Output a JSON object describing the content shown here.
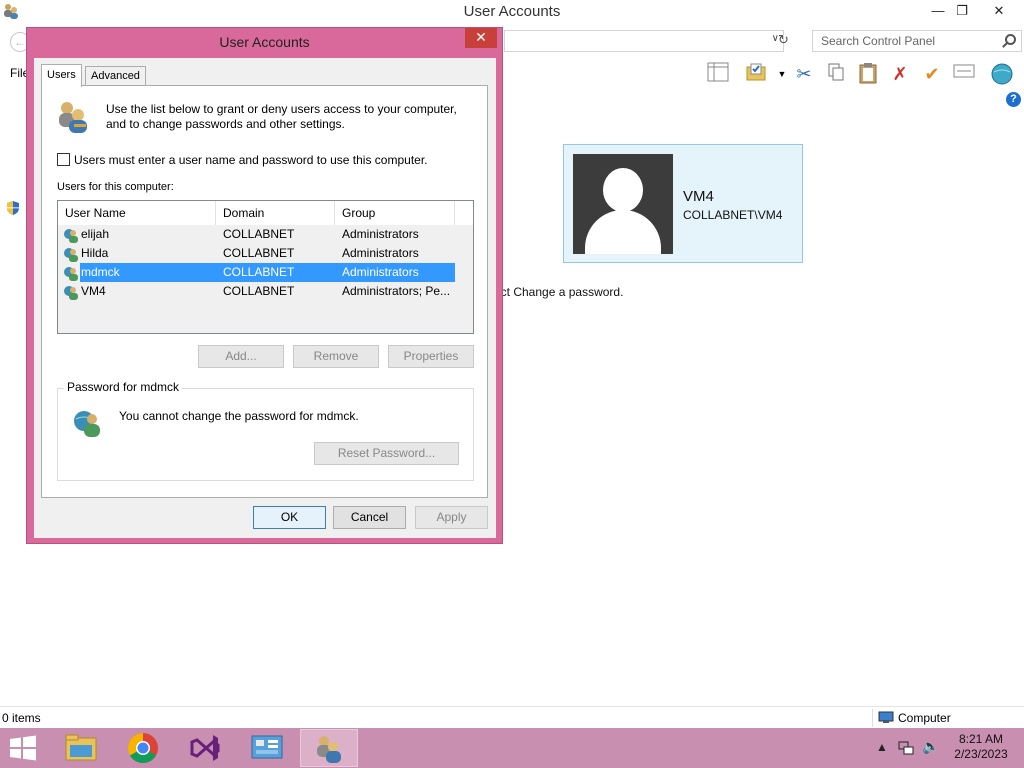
{
  "background_window": {
    "title": "User Accounts",
    "menu_file": "File",
    "search_placeholder": "Search Control Panel",
    "user_tile": {
      "name": "VM4",
      "domain": "COLLABNET\\VM4"
    },
    "hint_text": "ect Change a password.",
    "status_items": "0 items",
    "status_location": "Computer"
  },
  "dialog": {
    "title": "User Accounts",
    "tabs": [
      {
        "label": "Users"
      },
      {
        "label": "Advanced"
      }
    ],
    "intro_line1": "Use the list below to grant or deny users access to your computer,",
    "intro_line2": "and to change passwords and other settings.",
    "require_login_label": "Users must enter a user name and password to use this computer.",
    "users_caption": "Users for this computer:",
    "columns": [
      "User Name",
      "Domain",
      "Group"
    ],
    "users": [
      {
        "name": "elijah",
        "domain": "COLLABNET",
        "group": "Administrators"
      },
      {
        "name": "Hilda",
        "domain": "COLLABNET",
        "group": "Administrators"
      },
      {
        "name": "mdmck",
        "domain": "COLLABNET",
        "group": "Administrators"
      },
      {
        "name": "VM4",
        "domain": "COLLABNET",
        "group": "Administrators; Pe..."
      }
    ],
    "selected_user_index": 2,
    "add_label": "Add...",
    "remove_label": "Remove",
    "properties_label": "Properties",
    "password_group_label": "Password for mdmck",
    "password_text": "You cannot change the password for mdmck.",
    "reset_password_label": "Reset Password...",
    "ok_label": "OK",
    "cancel_label": "Cancel",
    "apply_label": "Apply"
  },
  "taskbar": {
    "time": "8:21 AM",
    "date": "2/23/2023",
    "apps": [
      "file-explorer",
      "chrome",
      "visual-studio",
      "control-panel",
      "user-accounts"
    ]
  },
  "colors": {
    "dialog_frame": "#d9699a",
    "taskbar": "#c98fb0",
    "selection": "#3399ff",
    "close_button": "#c7403a"
  }
}
